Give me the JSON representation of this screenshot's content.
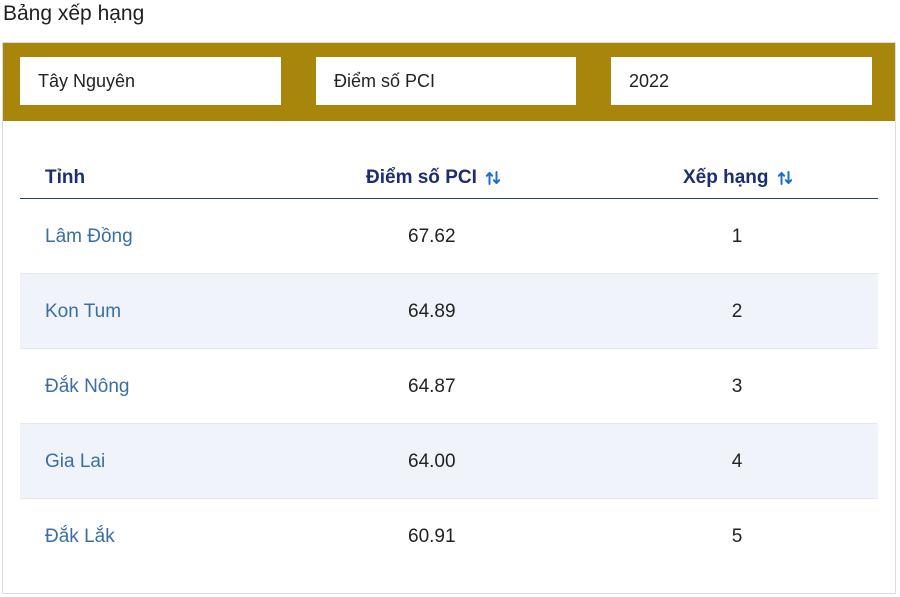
{
  "page": {
    "title": "Bảng xếp hạng"
  },
  "filters": {
    "region": "Tây Nguyên",
    "metric": "Điểm số PCI",
    "year": "2022"
  },
  "table": {
    "headers": {
      "province": "Tỉnh",
      "score": "Điểm số PCI",
      "rank": "Xếp hạng"
    },
    "rows": [
      {
        "province": "Lâm Đồng",
        "score": "67.62",
        "rank": "1"
      },
      {
        "province": "Kon Tum",
        "score": "64.89",
        "rank": "2"
      },
      {
        "province": "Đắk Nông",
        "score": "64.87",
        "rank": "3"
      },
      {
        "province": "Gia Lai",
        "score": "64.00",
        "rank": "4"
      },
      {
        "province": "Đắk Lắk",
        "score": "60.91",
        "rank": "5"
      }
    ]
  },
  "colors": {
    "filter_bar": "#a8860b",
    "header_text": "#1b2f6e",
    "province_link": "#3a6ea5",
    "sort_icon": "#1f6fc5",
    "alt_row": "#f0f4fa"
  },
  "icons": {
    "sort": "sort-arrows-icon"
  }
}
